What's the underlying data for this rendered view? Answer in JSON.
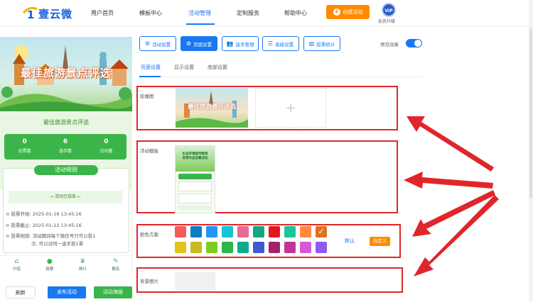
{
  "header": {
    "brand": "壹云微",
    "nav": [
      "用户首页",
      "模板中心",
      "活动管理",
      "定制服务",
      "帮助中心"
    ],
    "active_nav": "活动管理",
    "create_label": "创建活动",
    "vip_badge": "VIP",
    "vip_label": "会员升级"
  },
  "preview": {
    "banner_title": "最佳旅游景点评选",
    "subtitle": "最佳旅游景点评选",
    "stats": [
      {
        "value": "0",
        "label": "总票数"
      },
      {
        "value": "6",
        "label": "选手数"
      },
      {
        "value": "0",
        "label": "访问量"
      }
    ],
    "rules_title": "活动规则",
    "status": "活动已结束",
    "rules": [
      "投票开始:  2025-01-16 13:45:16",
      "投票截止:  2025-01-22 13:45:16",
      "投票规则:  活动期间每个微信号只可以投1",
      "次, 可以对同一选手投1票"
    ],
    "tabs": [
      {
        "icon": "home-icon",
        "glyph": "⌂",
        "label": "介绍"
      },
      {
        "icon": "vote-icon",
        "glyph": "●",
        "label": "投票"
      },
      {
        "icon": "rank-icon",
        "glyph": "♛",
        "label": "排行"
      },
      {
        "icon": "signup-icon",
        "glyph": "✎",
        "label": "报名"
      }
    ],
    "buttons": {
      "refresh": "刷新",
      "publish": "发布活动",
      "poster": "活动海报"
    }
  },
  "toolbar": {
    "buttons": [
      {
        "label": "活动设置",
        "icon": "gear-icon",
        "glyph": "⚙"
      },
      {
        "label": "页面设置",
        "icon": "gear-icon",
        "glyph": "⚙"
      },
      {
        "label": "选手管理",
        "icon": "users-icon",
        "glyph": "👥"
      },
      {
        "label": "高级设置",
        "icon": "sliders-icon",
        "glyph": "☰"
      },
      {
        "label": "投票统计",
        "icon": "chart-icon",
        "glyph": "▥"
      }
    ],
    "active": "页面设置",
    "preview_label": "预览效果",
    "preview_on": true
  },
  "subtabs": {
    "items": [
      "页面设置",
      "显示设置",
      "底部设置"
    ],
    "active": "页面设置"
  },
  "sections": {
    "carousel": {
      "label": "轮播图",
      "image_title": "最佳旅游景点评选",
      "add": "+"
    },
    "template": {
      "label": "活动模板",
      "thumb_title": "生态环境宣传教育\n优秀作品征集活动"
    },
    "colors": {
      "label": "配色方案",
      "row1": [
        "#f25c5c",
        "#0a7fc4",
        "#2196f3",
        "#19c2d6",
        "#e86a92",
        "#12a887",
        "#e2161f",
        "#1bc59c",
        "#ff8a3d",
        "#e0721f"
      ],
      "row2": [
        "#e3c21a",
        "#c9ba20",
        "#7fcc1f",
        "#28b84b",
        "#11a98f",
        "#3c5ad3",
        "#a3236a",
        "#c1339c",
        "#d45ad8",
        "#8e5cf0"
      ],
      "selected_index": 9,
      "default_label": "默认",
      "custom_label": "自定义"
    },
    "background": {
      "label": "背景图片"
    }
  }
}
